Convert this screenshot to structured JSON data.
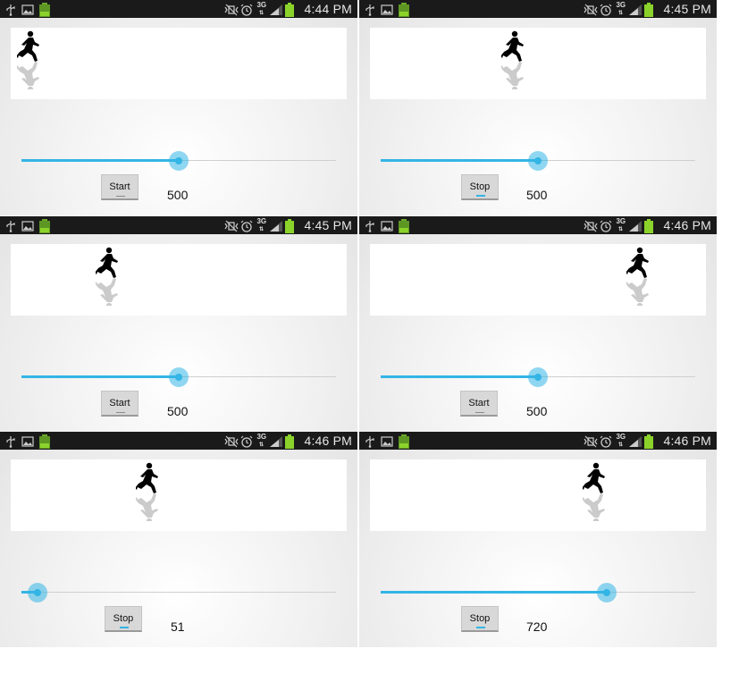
{
  "colors": {
    "accent": "#33b5e5",
    "status_bar": "#1a1a1a",
    "battery": "#8bd32b",
    "panel": "#ffffff"
  },
  "status_icons": [
    "usb-icon",
    "picture-icon",
    "battery-app-icon",
    "mute-vibrate-icon",
    "alarm-icon",
    "network-3g-icon",
    "signal-icon",
    "battery-icon"
  ],
  "network_label": "3G",
  "screens": [
    {
      "time": "4:44 PM",
      "runner_position": 0.02,
      "slider_value": 500,
      "slider_max": 1000,
      "button_label": "Start",
      "value_label": "500"
    },
    {
      "time": "4:45 PM",
      "runner_position": 0.42,
      "slider_value": 500,
      "slider_max": 1000,
      "button_label": "Stop",
      "value_label": "500"
    },
    {
      "time": "4:45 PM",
      "runner_position": 0.27,
      "slider_value": 500,
      "slider_max": 1000,
      "button_label": "Start",
      "value_label": "500"
    },
    {
      "time": "4:46 PM",
      "runner_position": 0.82,
      "slider_value": 500,
      "slider_max": 1000,
      "button_label": "Start",
      "value_label": "500"
    },
    {
      "time": "4:46 PM",
      "runner_position": 0.4,
      "slider_value": 51,
      "slider_max": 1000,
      "button_label": "Stop",
      "value_label": "51"
    },
    {
      "time": "4:46 PM",
      "runner_position": 0.68,
      "slider_value": 720,
      "slider_max": 1000,
      "button_label": "Stop",
      "value_label": "720"
    }
  ]
}
